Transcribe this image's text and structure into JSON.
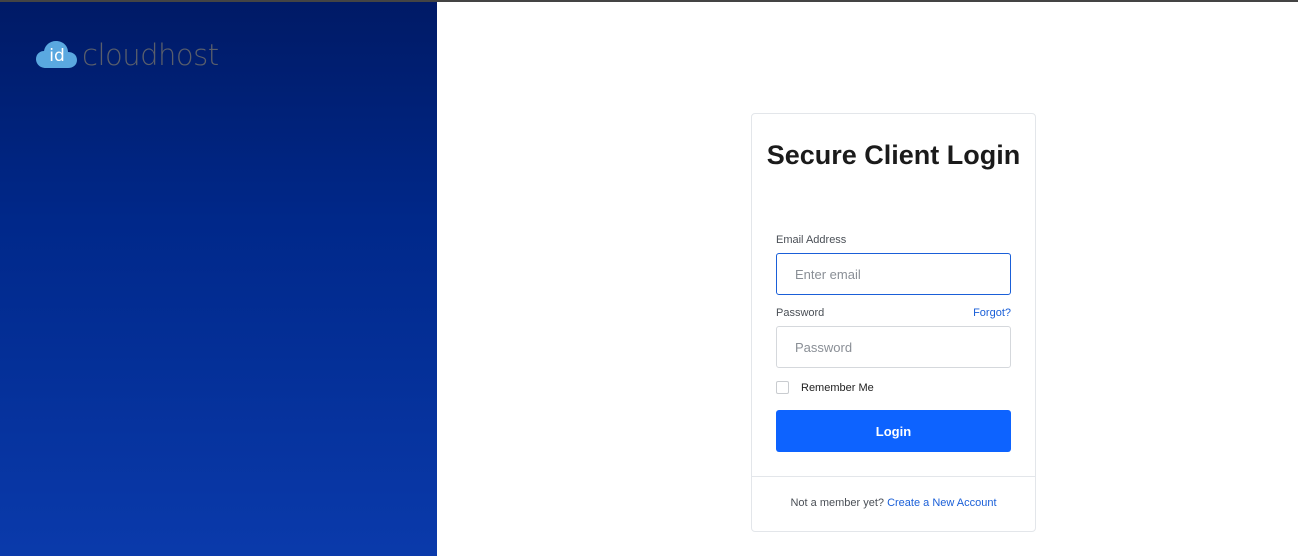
{
  "brand": {
    "logo_badge": "id",
    "name": "cloudhost",
    "cloud_color": "#5aa8e0",
    "panel_gradient": [
      "#001a66",
      "#0a3aab"
    ]
  },
  "login": {
    "title": "Secure Client Login",
    "email_label": "Email Address",
    "email_placeholder": "Enter email",
    "password_label": "Password",
    "forgot_link": "Forgot?",
    "password_placeholder": "Password",
    "remember_label": "Remember Me",
    "remember_checked": false,
    "submit_label": "Login",
    "accent_color": "#0d63ff"
  },
  "footer": {
    "prompt": "Not a member yet?",
    "create_link": "Create a New Account"
  }
}
